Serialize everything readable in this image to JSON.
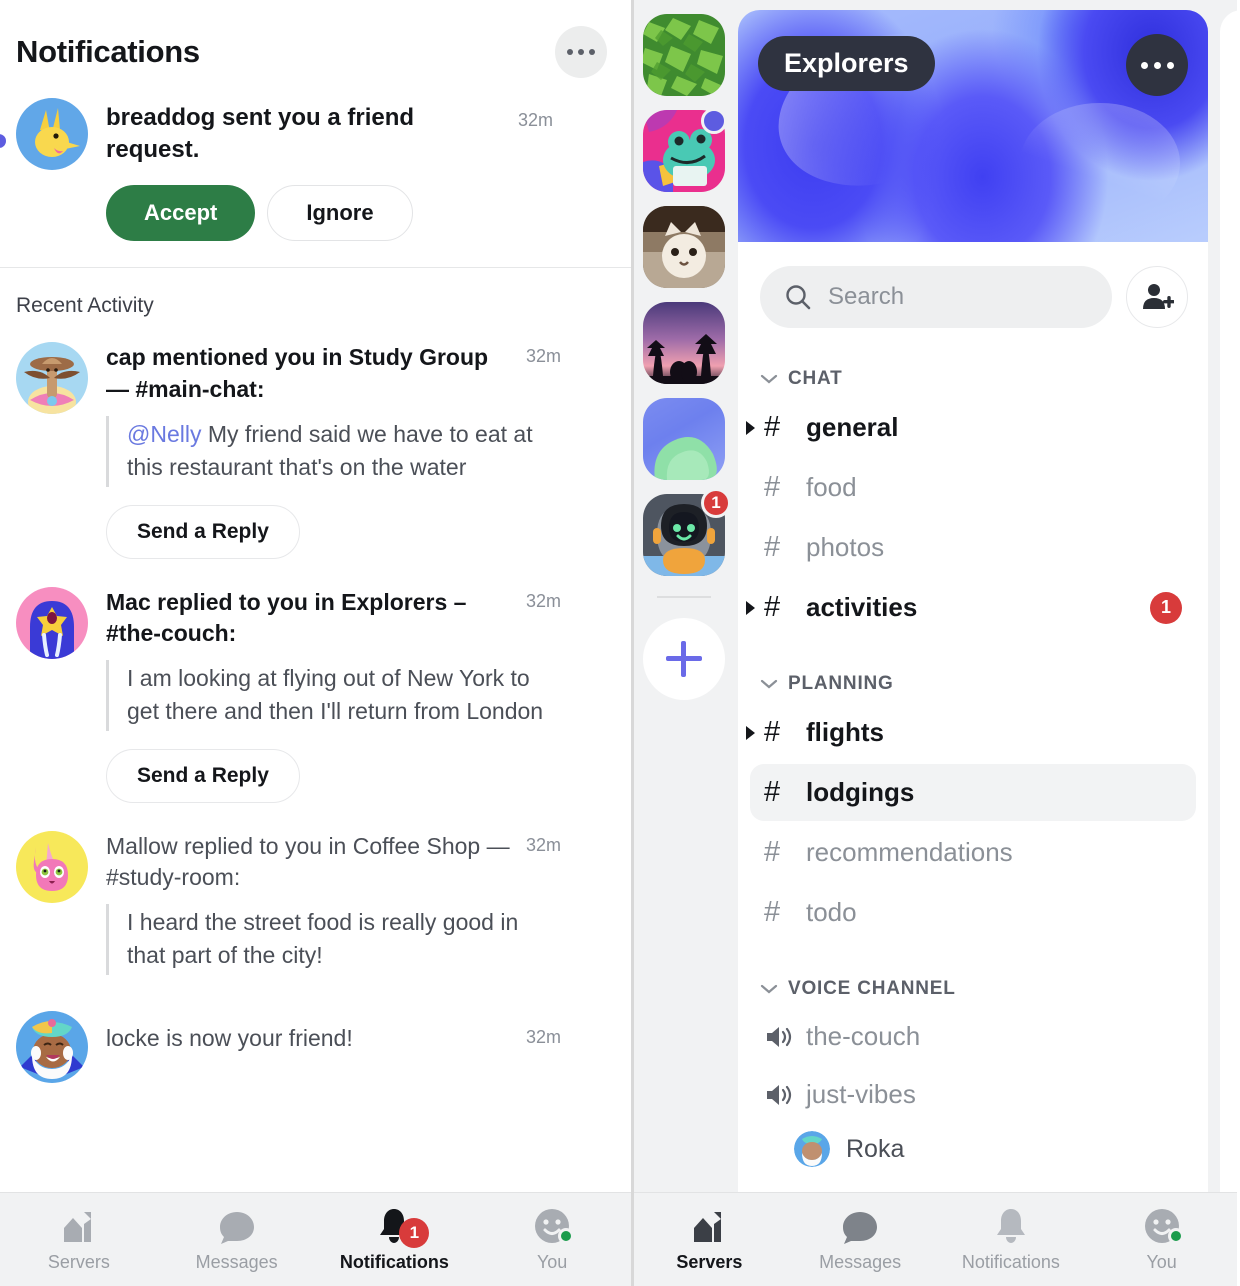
{
  "left": {
    "header": {
      "title": "Notifications",
      "more_icon": "more-horizontal-icon"
    },
    "friend_request": {
      "avatar": "breaddog-avatar",
      "text": "breaddog sent you a friend request.",
      "time": "32m",
      "accept_label": "Accept",
      "ignore_label": "Ignore",
      "unread": true
    },
    "recent_activity_label": "Recent Activity",
    "activities": [
      {
        "avatar": "cap-avatar",
        "headline": "cap mentioned you in Study Group — #main-chat:",
        "time": "32m",
        "mention": "@Nelly",
        "quote": " My friend said we have to eat at this restaurant that's on the water",
        "reply_label": "Send a Reply",
        "unread": true
      },
      {
        "avatar": "mac-avatar",
        "headline": "Mac replied to you in Explorers – #the-couch:",
        "time": "32m",
        "mention": "",
        "quote": "I am looking at flying out of New York to get there and then I'll return from London",
        "reply_label": "Send a Reply",
        "unread": true
      },
      {
        "avatar": "mallow-avatar",
        "headline": "Mallow replied to you in Coffee Shop — #study-room:",
        "time": "32m",
        "mention": "",
        "quote": "I heard the street food is really good in that part of the city!",
        "reply_label": "",
        "unread": false
      },
      {
        "avatar": "locke-avatar",
        "headline": "locke is now your friend!",
        "time": "32m",
        "mention": "",
        "quote": "",
        "reply_label": "",
        "unread": false
      }
    ],
    "tabs": [
      {
        "label": "Servers",
        "icon": "servers-icon",
        "active": false,
        "badge": ""
      },
      {
        "label": "Messages",
        "icon": "messages-icon",
        "active": false,
        "badge": ""
      },
      {
        "label": "Notifications",
        "icon": "bell-icon",
        "active": true,
        "badge": "1"
      },
      {
        "label": "You",
        "icon": "you-avatar-icon",
        "active": false,
        "badge": ""
      }
    ]
  },
  "right": {
    "servers": [
      {
        "name": "broccoli-server",
        "badge": "",
        "dot": false
      },
      {
        "name": "frog-server",
        "badge": "",
        "dot": true
      },
      {
        "name": "cat-server",
        "badge": "",
        "dot": false
      },
      {
        "name": "sunset-server",
        "badge": "",
        "dot": false
      },
      {
        "name": "green-blob-server",
        "badge": "",
        "dot": false
      },
      {
        "name": "robot-server",
        "badge": "1",
        "dot": false
      }
    ],
    "add_server_label": "+",
    "banner": {
      "server_name": "Explorers",
      "more_icon": "more-horizontal-icon"
    },
    "search": {
      "placeholder": "Search",
      "value": "",
      "icon": "search-icon"
    },
    "add_friend_icon": "add-person-icon",
    "categories": [
      {
        "label": "CHAT",
        "collapsed": false,
        "channels": [
          {
            "name": "general",
            "type": "text",
            "unread": true,
            "badge": "",
            "active": false
          },
          {
            "name": "food",
            "type": "text",
            "unread": false,
            "badge": "",
            "active": false
          },
          {
            "name": "photos",
            "type": "text",
            "unread": false,
            "badge": "",
            "active": false
          },
          {
            "name": "activities",
            "type": "text",
            "unread": true,
            "badge": "1",
            "active": false
          }
        ]
      },
      {
        "label": "PLANNING",
        "collapsed": false,
        "channels": [
          {
            "name": "flights",
            "type": "text",
            "unread": true,
            "badge": "",
            "active": false
          },
          {
            "name": "lodgings",
            "type": "text",
            "unread": true,
            "badge": "",
            "active": true
          },
          {
            "name": "recommendations",
            "type": "text",
            "unread": false,
            "badge": "",
            "active": false
          },
          {
            "name": "todo",
            "type": "text",
            "unread": false,
            "badge": "",
            "active": false
          }
        ]
      },
      {
        "label": "VOICE CHANNEL",
        "collapsed": false,
        "channels": [
          {
            "name": "the-couch",
            "type": "voice",
            "unread": false,
            "badge": "",
            "active": false
          },
          {
            "name": "just-vibes",
            "type": "voice",
            "unread": false,
            "badge": "",
            "active": false
          }
        ]
      }
    ],
    "voice_members": [
      {
        "name": "Roka",
        "avatar": "roka-avatar"
      }
    ],
    "tabs": [
      {
        "label": "Servers",
        "icon": "servers-icon",
        "active": true,
        "badge": ""
      },
      {
        "label": "Messages",
        "icon": "messages-icon",
        "active": false,
        "badge": ""
      },
      {
        "label": "Notifications",
        "icon": "bell-icon",
        "active": false,
        "badge": ""
      },
      {
        "label": "You",
        "icon": "you-avatar-icon",
        "active": false,
        "badge": ""
      }
    ]
  },
  "colors": {
    "accent_green": "#2d7d46",
    "badge_red": "#d83b3b",
    "unread_blue": "#5d5ce0",
    "mention_blue": "#6a79e0",
    "presence_green": "#1a9b4b",
    "pill_dark": "#2f3340"
  }
}
